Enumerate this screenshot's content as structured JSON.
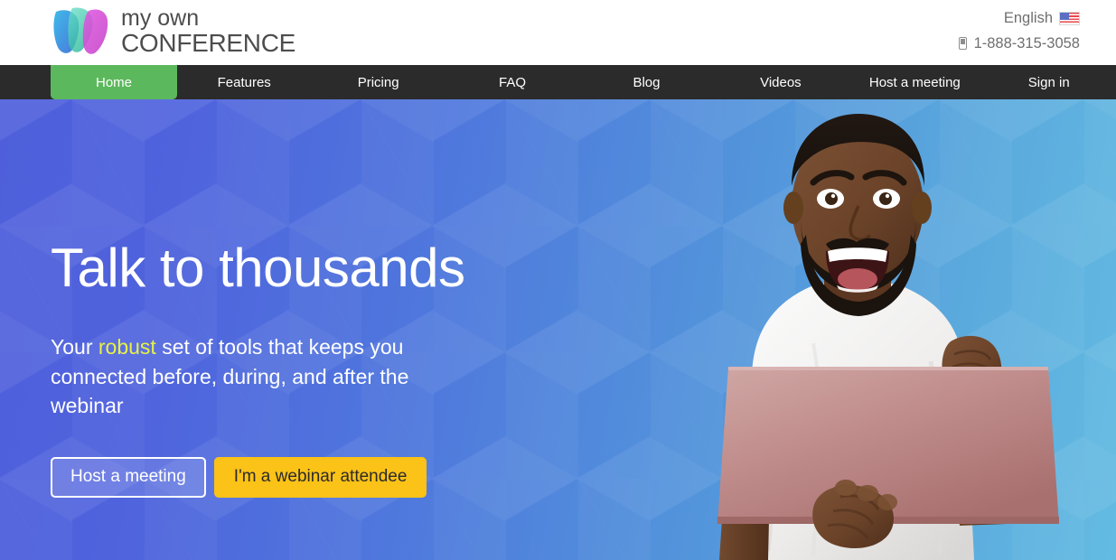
{
  "brand": {
    "logo_icon": "butterfly-wings-logo-icon",
    "name_line1": "my own",
    "name_line2": "CONFERENCE",
    "colors": {
      "logo_blue": "#3aa0e0",
      "logo_teal": "#3ec6a8",
      "logo_magenta": "#d94ad4"
    }
  },
  "topbar": {
    "language_label": "English",
    "language_flag_icon": "us-flag-icon",
    "phone_icon": "mobile-phone-icon",
    "phone_number": "1-888-315-3058"
  },
  "nav": {
    "active_index": 0,
    "active_color": "#5cb85c",
    "background_color": "#2b2b2b",
    "items": [
      {
        "label": "Home"
      },
      {
        "label": "Features"
      },
      {
        "label": "Pricing"
      },
      {
        "label": "FAQ"
      },
      {
        "label": "Blog"
      },
      {
        "label": "Videos"
      },
      {
        "label": "Host a meeting"
      },
      {
        "label": "Sign in"
      }
    ]
  },
  "hero": {
    "title": "Talk to thousands",
    "subtitle_part1": "Your ",
    "subtitle_highlight": "robust",
    "subtitle_part2": " set of tools that keeps you connected before, during, and after the webinar",
    "highlight_color": "#e8f243",
    "gradient_from": "#4f5fdb",
    "gradient_to": "#63bbe2",
    "background_pattern": "isometric-cubes",
    "buttons": {
      "secondary_label": "Host a meeting",
      "primary_label": "I'm a webinar attendee",
      "primary_color": "#fbc217"
    },
    "photo": {
      "alt": "smiling-man-holding-laptop",
      "shirt_color": "#f2f2f2",
      "laptop_color": "#c08b8b",
      "skin_color": "#6b4530"
    }
  }
}
